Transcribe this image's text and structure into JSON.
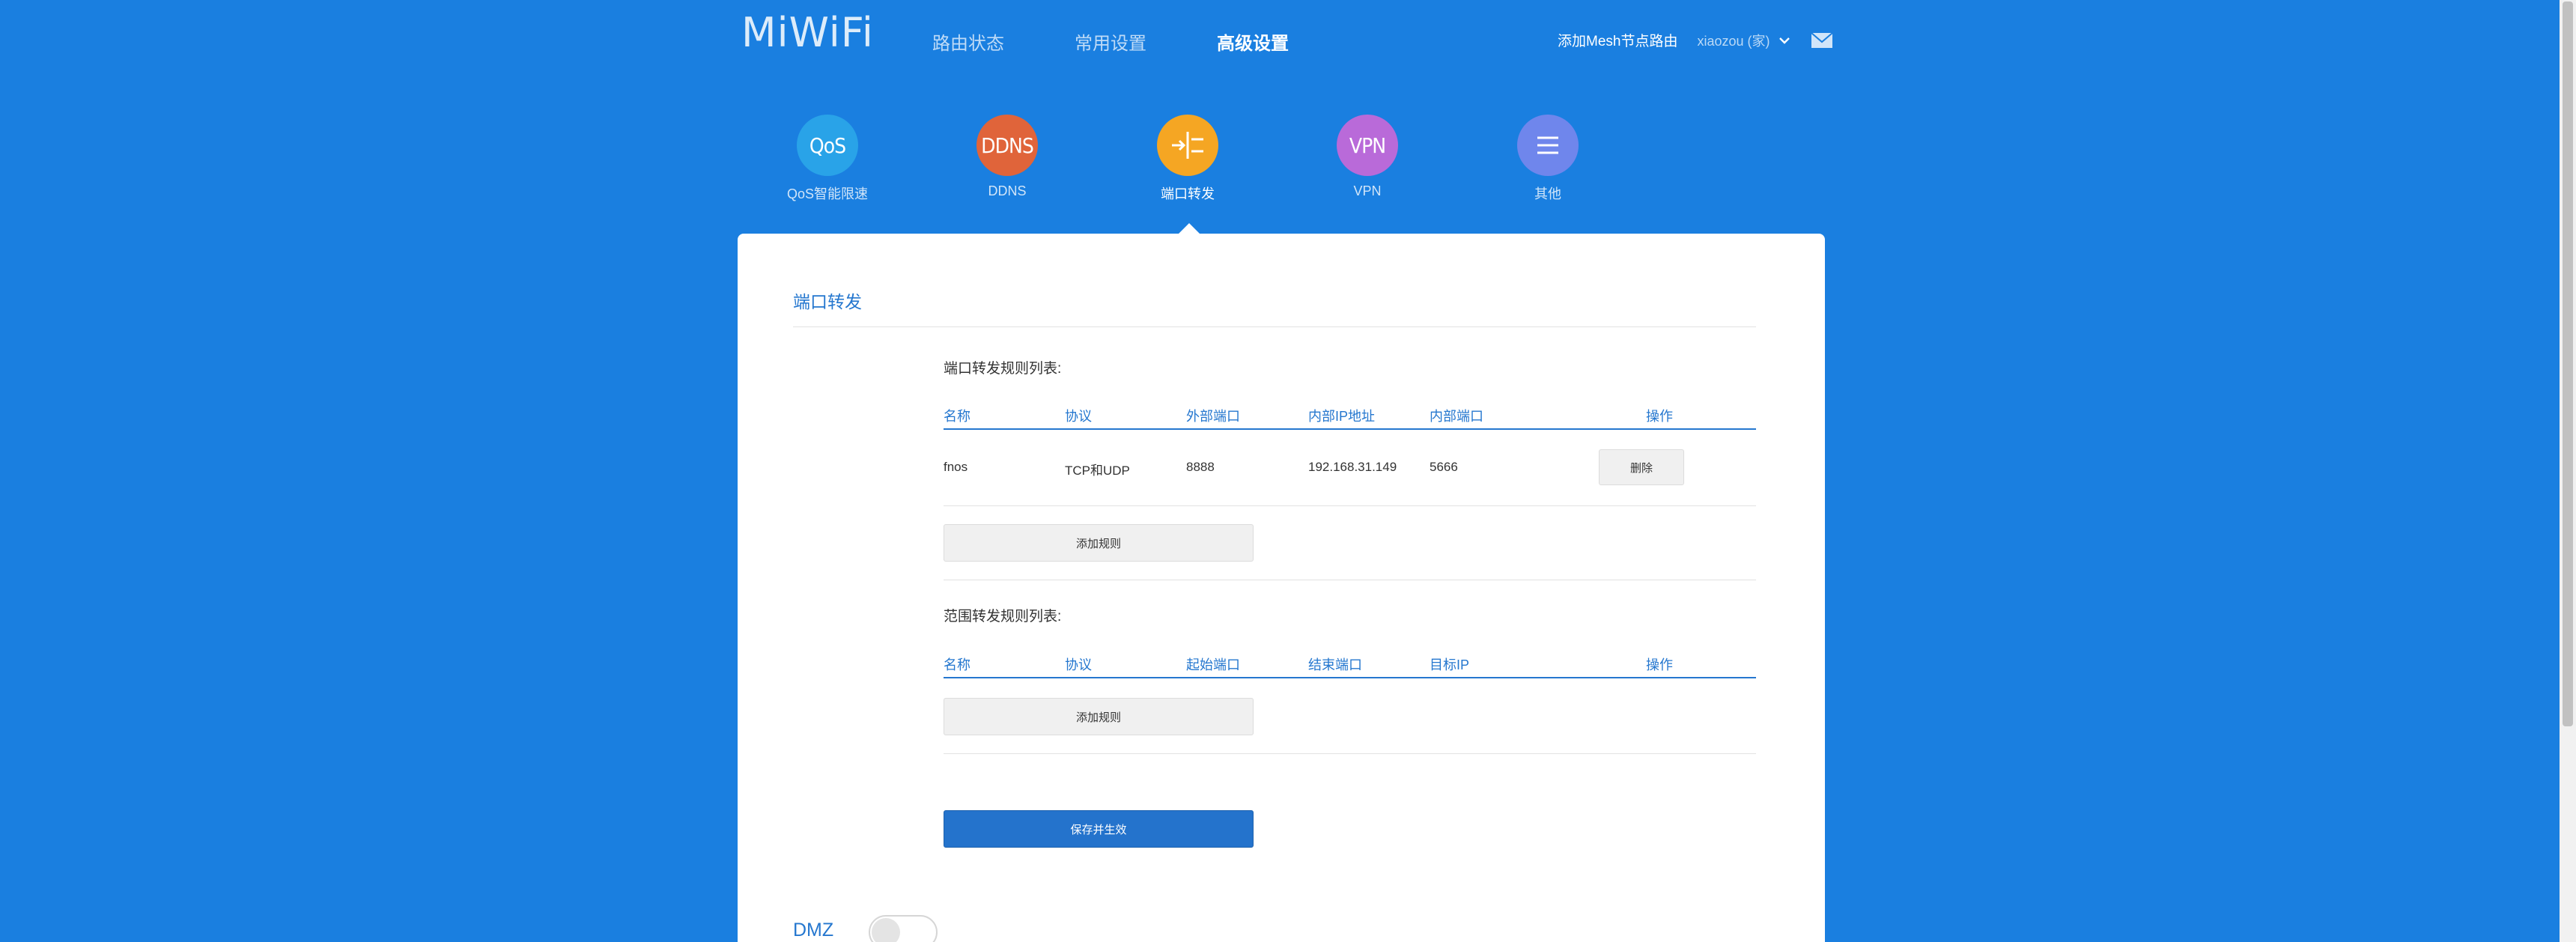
{
  "header": {
    "logo": "MiWiFi",
    "nav": [
      {
        "label": "路由状态",
        "active": false
      },
      {
        "label": "常用设置",
        "active": false
      },
      {
        "label": "高级设置",
        "active": true
      }
    ],
    "mesh_link": "添加Mesh节点路由",
    "user": "xiaozou (家)"
  },
  "features": [
    {
      "label": "QoS智能限速",
      "icon_text": "QoS",
      "color": "#29a3e8",
      "icon": "qos-icon"
    },
    {
      "label": "DDNS",
      "icon_text": "DDNS",
      "color": "#e0643a",
      "icon": "ddns-icon"
    },
    {
      "label": "端口转发",
      "icon_text": "",
      "color": "#f5a623",
      "icon": "port-forward-icon",
      "active": true
    },
    {
      "label": "VPN",
      "icon_text": "VPN",
      "color": "#b96ad9",
      "icon": "vpn-icon"
    },
    {
      "label": "其他",
      "icon_text": "",
      "color": "#6f86ec",
      "icon": "menu-icon"
    }
  ],
  "card": {
    "title": "端口转发",
    "port_rules": {
      "title": "端口转发规则列表:",
      "columns": [
        "名称",
        "协议",
        "外部端口",
        "内部IP地址",
        "内部端口",
        "操作"
      ],
      "rows": [
        {
          "name": "fnos",
          "protocol": "TCP和UDP",
          "ext_port": "8888",
          "internal_ip": "192.168.31.149",
          "int_port": "5666",
          "action": "删除"
        }
      ],
      "add_button": "添加规则"
    },
    "range_rules": {
      "title": "范围转发规则列表:",
      "columns": [
        "名称",
        "协议",
        "起始端口",
        "结束端口",
        "目标IP",
        "操作"
      ],
      "add_button": "添加规则"
    },
    "save_button": "保存并生效",
    "dmz_label": "DMZ",
    "dmz_enabled": false
  },
  "colors": {
    "background": "#1a7fe0",
    "accent": "#2577cf",
    "save_button": "#2473cc"
  }
}
